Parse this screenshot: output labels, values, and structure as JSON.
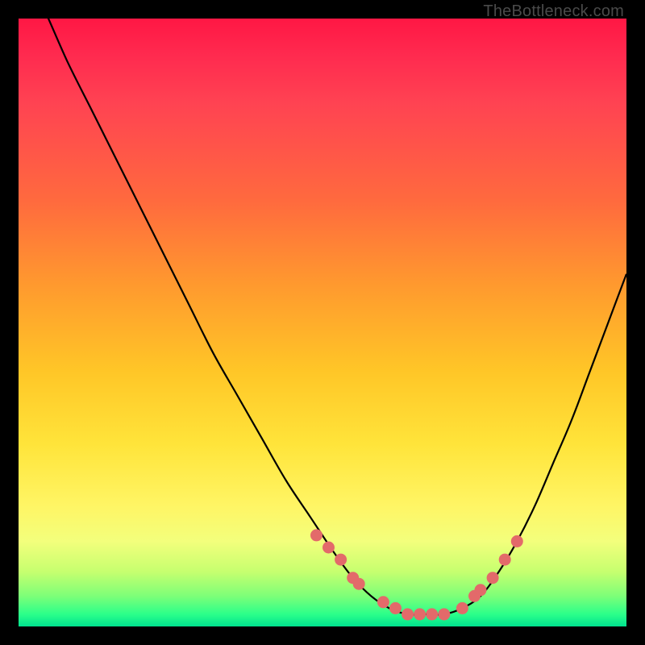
{
  "attribution": "TheBottleneck.com",
  "colors": {
    "background": "#000000",
    "gradient_top": "#ff1744",
    "gradient_mid": "#ffe43a",
    "gradient_bottom": "#00e18e",
    "curve_stroke": "#000000",
    "marker_fill": "#e36a6a",
    "marker_stroke": "#e36a6a"
  },
  "chart_data": {
    "type": "line",
    "title": "",
    "xlabel": "",
    "ylabel": "",
    "xlim": [
      0,
      100
    ],
    "ylim": [
      0,
      100
    ],
    "x": [
      0,
      4,
      8,
      12,
      16,
      20,
      24,
      28,
      32,
      36,
      40,
      44,
      48,
      52,
      55,
      58,
      61,
      64,
      67,
      70,
      73,
      76,
      79,
      82,
      85,
      88,
      91,
      94,
      97,
      100
    ],
    "values": [
      110,
      102,
      93,
      85,
      77,
      69,
      61,
      53,
      45,
      38,
      31,
      24,
      18,
      12,
      8,
      5,
      3,
      2,
      2,
      2,
      3,
      5,
      9,
      14,
      20,
      27,
      34,
      42,
      50,
      58
    ],
    "markers": {
      "x": [
        49,
        51,
        53,
        55,
        56,
        60,
        62,
        64,
        66,
        68,
        70,
        73,
        75,
        76,
        78,
        80,
        82
      ],
      "y": [
        15,
        13,
        11,
        8,
        7,
        4,
        3,
        2,
        2,
        2,
        2,
        3,
        5,
        6,
        8,
        11,
        14
      ]
    }
  }
}
